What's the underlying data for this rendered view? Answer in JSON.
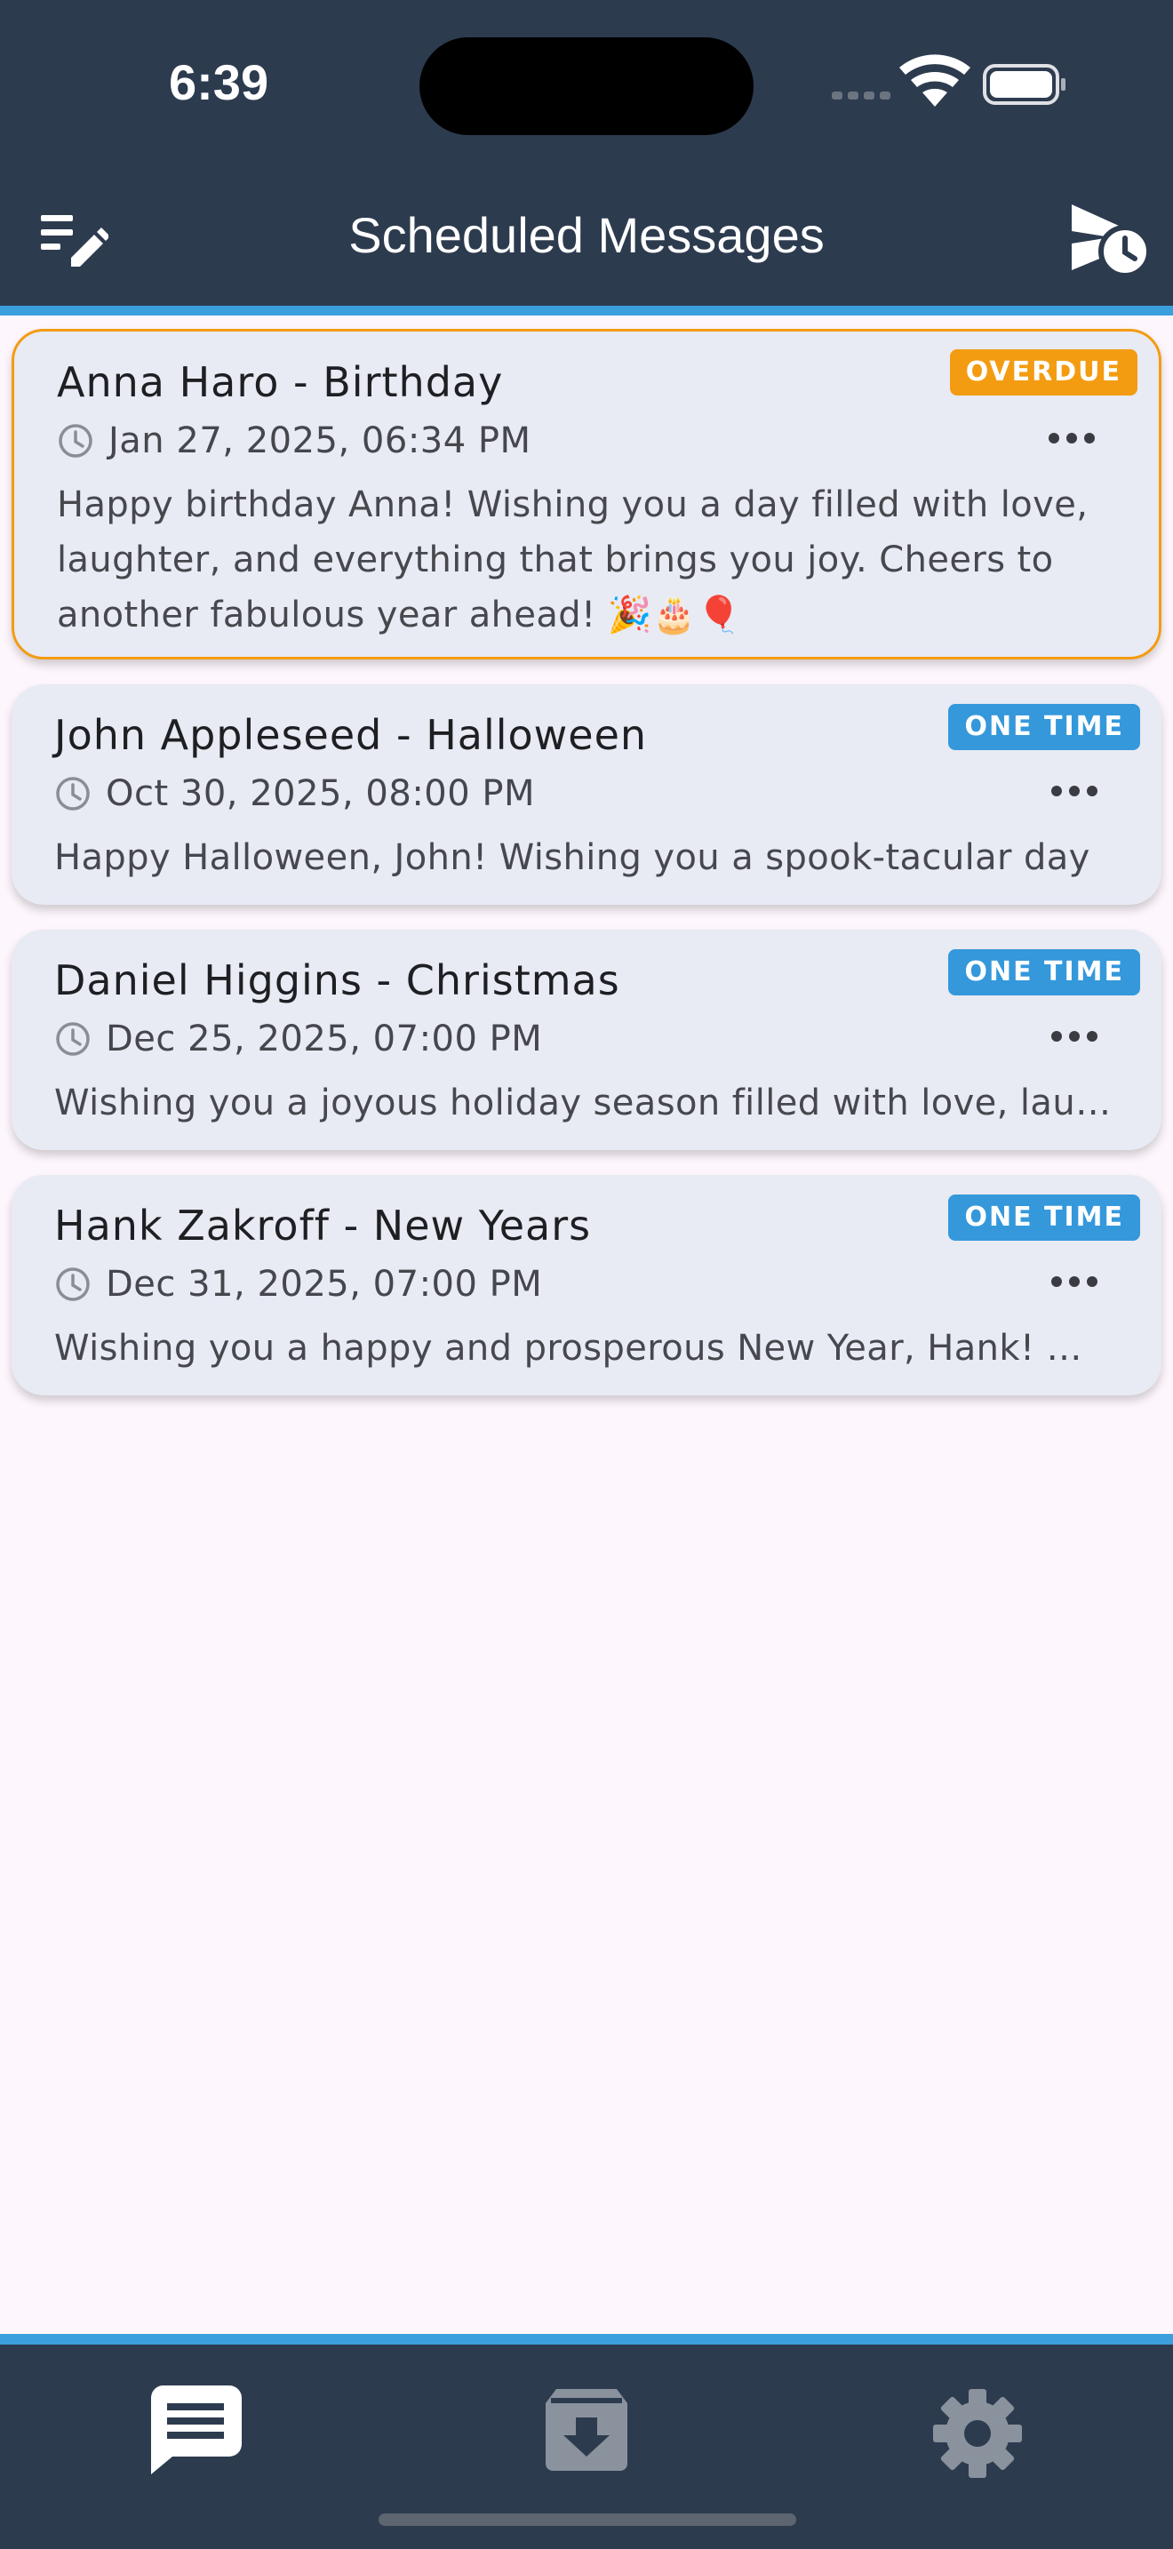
{
  "status_bar": {
    "time": "6:39"
  },
  "header": {
    "title": "Scheduled Messages",
    "left_icon": "compose-list-icon",
    "right_icon": "scheduled-send-icon"
  },
  "messages": [
    {
      "title": "Anna Haro - Birthday",
      "datetime": "Jan 27, 2025, 06:34 PM",
      "badge": "OVERDUE",
      "badge_color": "#f39c12",
      "body": "Happy birthday Anna! Wishing you a day filled with love, laughter, and everything that brings you joy. Cheers to another fabulous year ahead! 🎉🎂🎈"
    },
    {
      "title": "John Appleseed - Halloween",
      "datetime": "Oct 30, 2025, 08:00 PM",
      "badge": "ONE TIME",
      "badge_color": "#3498db",
      "body": "Happy Halloween, John! Wishing you a spook-tacular day"
    },
    {
      "title": "Daniel Higgins - Christmas",
      "datetime": "Dec 25, 2025, 07:00 PM",
      "badge": "ONE TIME",
      "badge_color": "#3498db",
      "body": "Wishing you a joyous holiday season filled with love, laughter"
    },
    {
      "title": "Hank Zakroff - New Years",
      "datetime": "Dec 31, 2025, 07:00 PM",
      "badge": "ONE TIME",
      "badge_color": "#3498db",
      "body": "Wishing you a happy and prosperous New Year, Hank! May"
    }
  ],
  "tabs": [
    {
      "icon": "chat-icon",
      "active": true
    },
    {
      "icon": "archive-icon",
      "active": false
    },
    {
      "icon": "settings-gear-icon",
      "active": false
    }
  ],
  "colors": {
    "header_bg": "#2d3b4f",
    "accent_stripe": "#3b9fdd",
    "page_bg": "#fdf6fc",
    "card_bg": "#e8eaf4",
    "overdue": "#f39c12",
    "one_time": "#3498db",
    "tab_active": "#ffffff",
    "tab_inactive": "#8a929d"
  }
}
